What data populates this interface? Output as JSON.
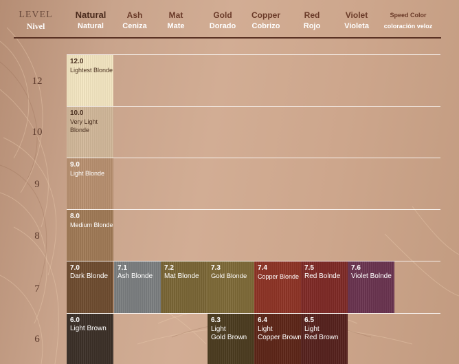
{
  "header": {
    "level": {
      "en": "LEVEL",
      "es": "Nivel"
    },
    "columns": [
      {
        "en": "Natural",
        "es": "Natural"
      },
      {
        "en": "Ash",
        "es": "Ceniza"
      },
      {
        "en": "Mat",
        "es": "Mate"
      },
      {
        "en": "Gold",
        "es": "Dorado"
      },
      {
        "en": "Copper",
        "es": "Cobrizo"
      },
      {
        "en": "Red",
        "es": "Rojo"
      },
      {
        "en": "Violet",
        "es": "Violeta"
      },
      {
        "en": "Speed Color",
        "es": "coloración veloz"
      }
    ]
  },
  "levels": [
    "12",
    "10",
    "9",
    "8",
    "7",
    "6"
  ],
  "swatches": [
    {
      "code": "12.0",
      "name": "Lightest Blonde",
      "color": "#f4e7c2"
    },
    {
      "code": "10.0",
      "name": "Very Light Blonde",
      "color": "#d2b89a"
    },
    {
      "code": "9.0",
      "name": "Light Blonde",
      "color": "#b89070"
    },
    {
      "code": "8.0",
      "name": "Medium Blonde",
      "color": "#a07a56"
    },
    {
      "code": "7.0",
      "name": "Dark Blonde",
      "color": "#6f4d30"
    },
    {
      "code": "7.1",
      "name": "Ash Blonde",
      "color": "#7b7e80"
    },
    {
      "code": "7.2",
      "name": "Mat Blonde",
      "color": "#7a6636"
    },
    {
      "code": "7.3",
      "name": "Gold Blonde",
      "color": "#7e6a38"
    },
    {
      "code": "7.4",
      "name": "Copper Blonde",
      "color": "#8e3426"
    },
    {
      "code": "7.5",
      "name": "Red Bolnde",
      "color": "#7e2a26"
    },
    {
      "code": "7.6",
      "name": "Violet Bolnde",
      "color": "#6a3450"
    },
    {
      "code": "6.0",
      "name": "Light Brown",
      "color": "#3c3028"
    },
    {
      "code": "6.3",
      "name": "Light\nGold Brown",
      "color": "#4c3c20"
    },
    {
      "code": "6.4",
      "name": "Light\nCopper Brown",
      "color": "#5e2618"
    },
    {
      "code": "6.5",
      "name": "Light\nRed Brown",
      "color": "#56221e"
    }
  ]
}
